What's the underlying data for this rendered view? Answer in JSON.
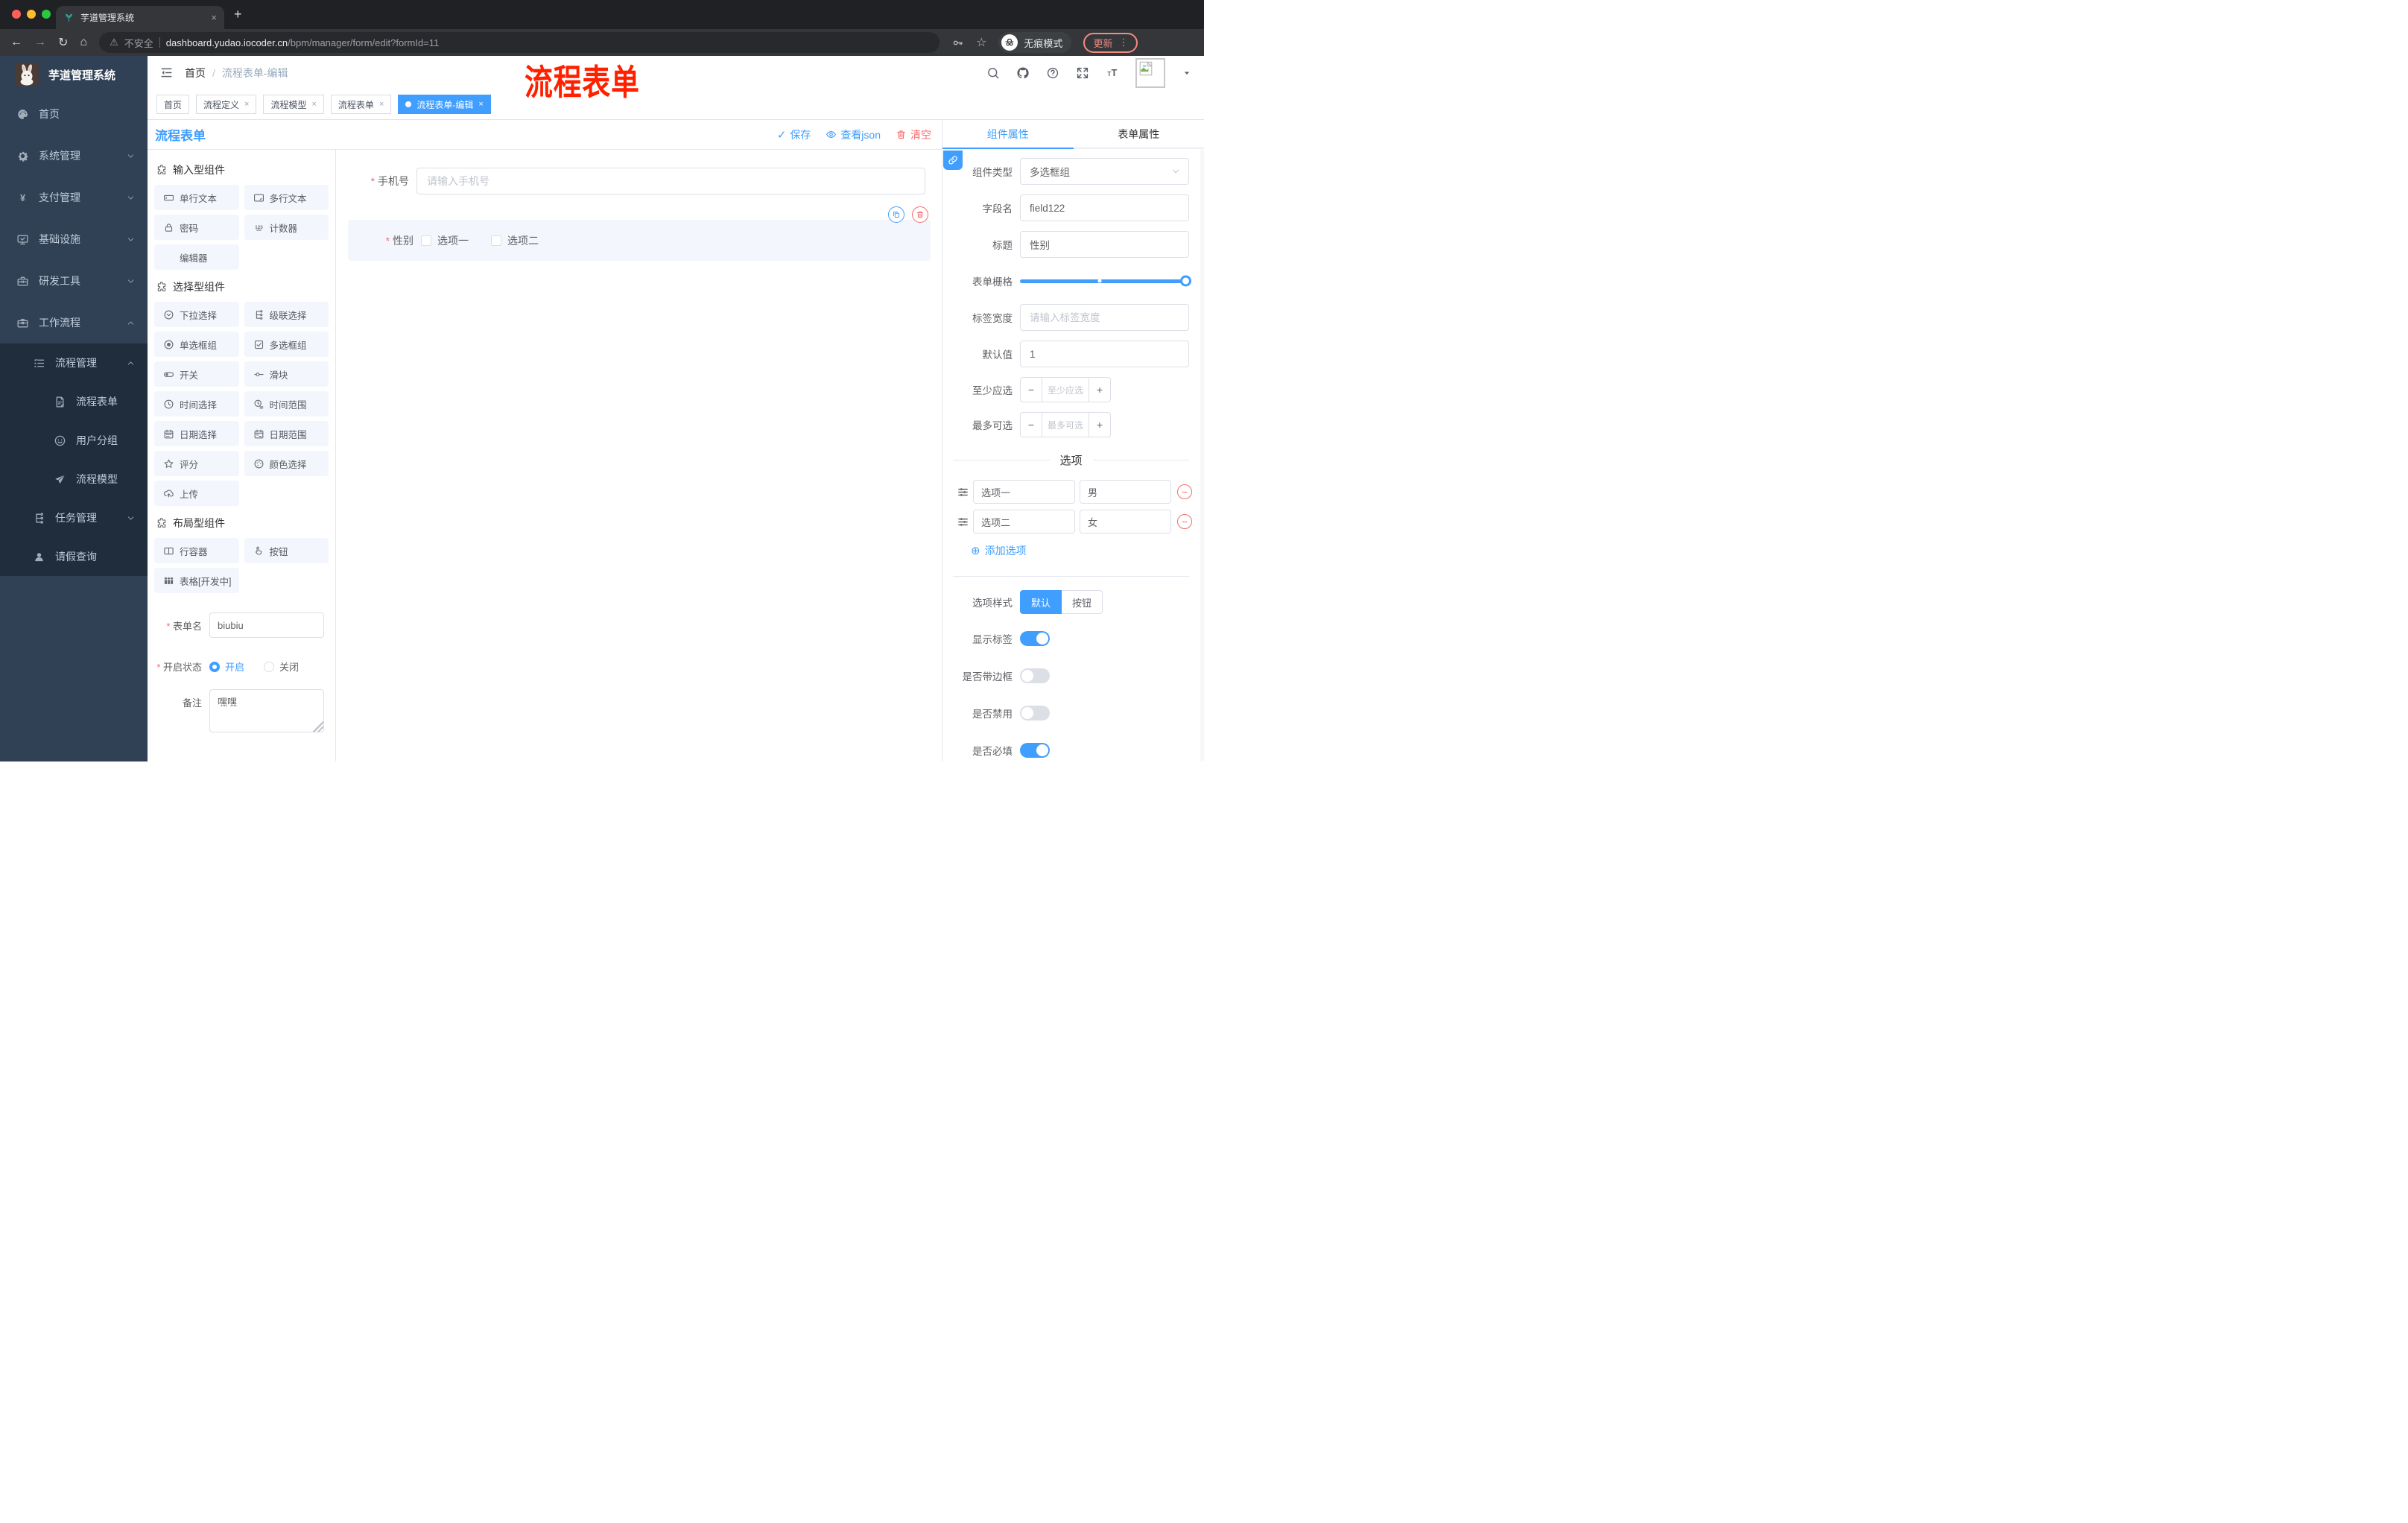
{
  "browser": {
    "tab_title": "芋道管理系统",
    "security_label": "不安全",
    "url_domain": "dashboard.yudao.iocoder.cn",
    "url_path": "/bpm/manager/form/edit?formId=11",
    "incognito_label": "无痕模式",
    "update_label": "更新"
  },
  "sidebar": {
    "logo_title": "芋道管理系统",
    "items": [
      {
        "name": "home",
        "icon": "palette-icon",
        "label": "首页",
        "level": 0,
        "chevron": ""
      },
      {
        "name": "system-mgmt",
        "icon": "gear-icon",
        "label": "系统管理",
        "level": 0,
        "chevron": "down"
      },
      {
        "name": "payment-mgmt",
        "icon": "yen-icon",
        "label": "支付管理",
        "level": 0,
        "chevron": "down"
      },
      {
        "name": "infrastructure",
        "icon": "monitor-icon",
        "label": "基础设施",
        "level": 0,
        "chevron": "down"
      },
      {
        "name": "dev-tools",
        "icon": "toolbox-icon",
        "label": "研发工具",
        "level": 0,
        "chevron": "down"
      },
      {
        "name": "workflow",
        "icon": "briefcase-icon",
        "label": "工作流程",
        "level": 0,
        "chevron": "up"
      },
      {
        "name": "process-mgmt",
        "icon": "flowlist-icon",
        "label": "流程管理",
        "level": 1,
        "chevron": "up"
      },
      {
        "name": "process-form",
        "icon": "form-icon",
        "label": "流程表单",
        "level": 2,
        "chevron": ""
      },
      {
        "name": "user-group",
        "icon": "face-icon",
        "label": "用户分组",
        "level": 2,
        "chevron": ""
      },
      {
        "name": "process-model",
        "icon": "plane-icon",
        "label": "流程模型",
        "level": 2,
        "chevron": ""
      },
      {
        "name": "task-mgmt",
        "icon": "tree-icon",
        "label": "任务管理",
        "level": 1,
        "chevron": "down"
      },
      {
        "name": "leave-query",
        "icon": "person-icon",
        "label": "请假查询",
        "level": 1,
        "chevron": ""
      }
    ]
  },
  "header": {
    "breadcrumb_home": "首页",
    "breadcrumb_sep": "/",
    "breadcrumb_current": "流程表单-编辑",
    "annotation": "流程表单"
  },
  "tabs_bar": {
    "tabs": [
      {
        "label": "首页",
        "closable": false,
        "active": false
      },
      {
        "label": "流程定义",
        "closable": true,
        "active": false
      },
      {
        "label": "流程模型",
        "closable": true,
        "active": false
      },
      {
        "label": "流程表单",
        "closable": true,
        "active": false
      },
      {
        "label": "流程表单-编辑",
        "closable": true,
        "active": true
      }
    ]
  },
  "designer": {
    "title": "流程表单",
    "save_label": "保存",
    "view_json_label": "查看json",
    "clear_label": "清空",
    "palette_sections": [
      {
        "title": "输入型组件",
        "items": [
          {
            "icon": "text-field-icon",
            "label": "单行文本"
          },
          {
            "icon": "textarea-icon",
            "label": "多行文本"
          },
          {
            "icon": "lock-icon",
            "label": "密码"
          },
          {
            "icon": "counter-icon",
            "label": "计数器"
          },
          {
            "icon": "",
            "label": "编辑器"
          }
        ]
      },
      {
        "title": "选择型组件",
        "items": [
          {
            "icon": "select-icon",
            "label": "下拉选择"
          },
          {
            "icon": "cascader-icon",
            "label": "级联选择"
          },
          {
            "icon": "radio-icon",
            "label": "单选框组"
          },
          {
            "icon": "checkbox-icon",
            "label": "多选框组"
          },
          {
            "icon": "switch-icon",
            "label": "开关"
          },
          {
            "icon": "slider-icon",
            "label": "滑块"
          },
          {
            "icon": "time-icon",
            "label": "时间选择"
          },
          {
            "icon": "time-range-icon",
            "label": "时间范围"
          },
          {
            "icon": "date-icon",
            "label": "日期选择"
          },
          {
            "icon": "date-range-icon",
            "label": "日期范围"
          },
          {
            "icon": "star-icon",
            "label": "评分"
          },
          {
            "icon": "color-icon",
            "label": "颜色选择"
          },
          {
            "icon": "upload-icon",
            "label": "上传"
          }
        ]
      },
      {
        "title": "布局型组件",
        "items": [
          {
            "icon": "row-icon",
            "label": "行容器"
          },
          {
            "icon": "pointer-icon",
            "label": "按钮"
          },
          {
            "icon": "table-icon",
            "label": "表格[开发中]"
          }
        ]
      }
    ],
    "meta": {
      "form_name_label": "表单名",
      "form_name_value": "biubiu",
      "status_label": "开启状态",
      "status_on": "开启",
      "status_off": "关闭",
      "remark_label": "备注",
      "remark_value": "嘿嘿"
    },
    "canvas": {
      "phone_label": "手机号",
      "phone_placeholder": "请输入手机号",
      "gender_label": "性别",
      "gender_opt1": "选项一",
      "gender_opt2": "选项二"
    }
  },
  "props": {
    "tab_component": "组件属性",
    "tab_form": "表单属性",
    "component_type_label": "组件类型",
    "component_type_value": "多选框组",
    "field_name_label": "字段名",
    "field_name_value": "field122",
    "title_label": "标题",
    "title_value": "性别",
    "grid_label": "表单栅格",
    "label_width_label": "标签宽度",
    "label_width_placeholder": "请输入标签宽度",
    "default_label": "默认值",
    "default_value": "1",
    "min_label": "至少应选",
    "min_placeholder": "至少应选",
    "max_label": "最多可选",
    "max_placeholder": "最多可选",
    "options_title": "选项",
    "options": [
      {
        "label": "选项一",
        "value": "男"
      },
      {
        "label": "选项二",
        "value": "女"
      }
    ],
    "add_option_label": "添加选项",
    "option_style_label": "选项样式",
    "seg_default": "默认",
    "seg_button": "按钮",
    "toggles": [
      {
        "label": "显示标签",
        "on": true
      },
      {
        "label": "是否带边框",
        "on": false
      },
      {
        "label": "是否禁用",
        "on": false
      },
      {
        "label": "是否必填",
        "on": true
      }
    ]
  },
  "colors": {
    "accent": "#409eff",
    "danger": "#f56c6c",
    "annotation_red": "#ff2000",
    "sidebar_bg": "#304156",
    "submenu_bg": "#1f2d3d",
    "chrome_frame": "#202124",
    "chrome_toolbar": "#35363a",
    "update_pill": "#f28b82",
    "palette_item_bg": "#f4f6fe",
    "selected_block_bg": "#f4f6fe"
  }
}
